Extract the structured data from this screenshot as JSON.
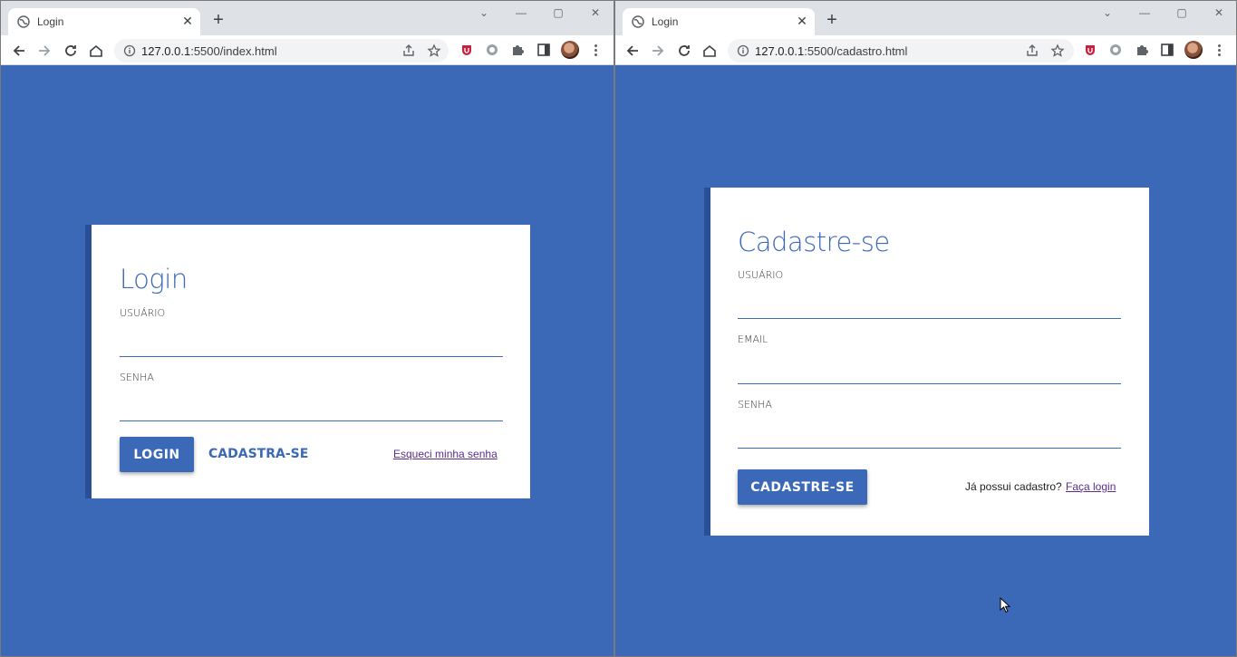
{
  "left_window": {
    "tab_title": "Login",
    "url_host": "127.0.0.1",
    "url_rest": ":5500/index.html",
    "card": {
      "title": "Login",
      "user_label": "USUÁRIO",
      "user_value": "",
      "password_label": "SENHA",
      "password_value": "",
      "login_button": "LOGIN",
      "register_link": "CADASTRA-SE",
      "forgot_link": "Esqueci minha senha"
    }
  },
  "right_window": {
    "tab_title": "Login",
    "url_host": "127.0.0.1",
    "url_rest": ":5500/cadastro.html",
    "card": {
      "title": "Cadastre-se",
      "user_label": "USUÁRIO",
      "user_value": "",
      "email_label": "EMAIL",
      "email_value": "",
      "password_label": "SENHA",
      "password_value": "",
      "register_button": "CADASTRE-SE",
      "already_text": "Já possui cadastro?",
      "login_link": "Faça login"
    }
  },
  "colors": {
    "background": "#3b69b8",
    "card_border": "#2a4f96",
    "title": "#3b69b8",
    "link_visited": "#5b2d8e"
  },
  "icons": [
    "globe-icon",
    "close-icon",
    "plus-icon",
    "back-icon",
    "forward-icon",
    "reload-icon",
    "home-icon",
    "info-icon",
    "share-icon",
    "star-icon",
    "extension-icon",
    "puzzle-icon",
    "sidepanel-icon",
    "avatar",
    "menu-icon",
    "minimize-icon",
    "maximize-icon",
    "window-close-icon",
    "tab-search-icon",
    "cursor-icon"
  ]
}
